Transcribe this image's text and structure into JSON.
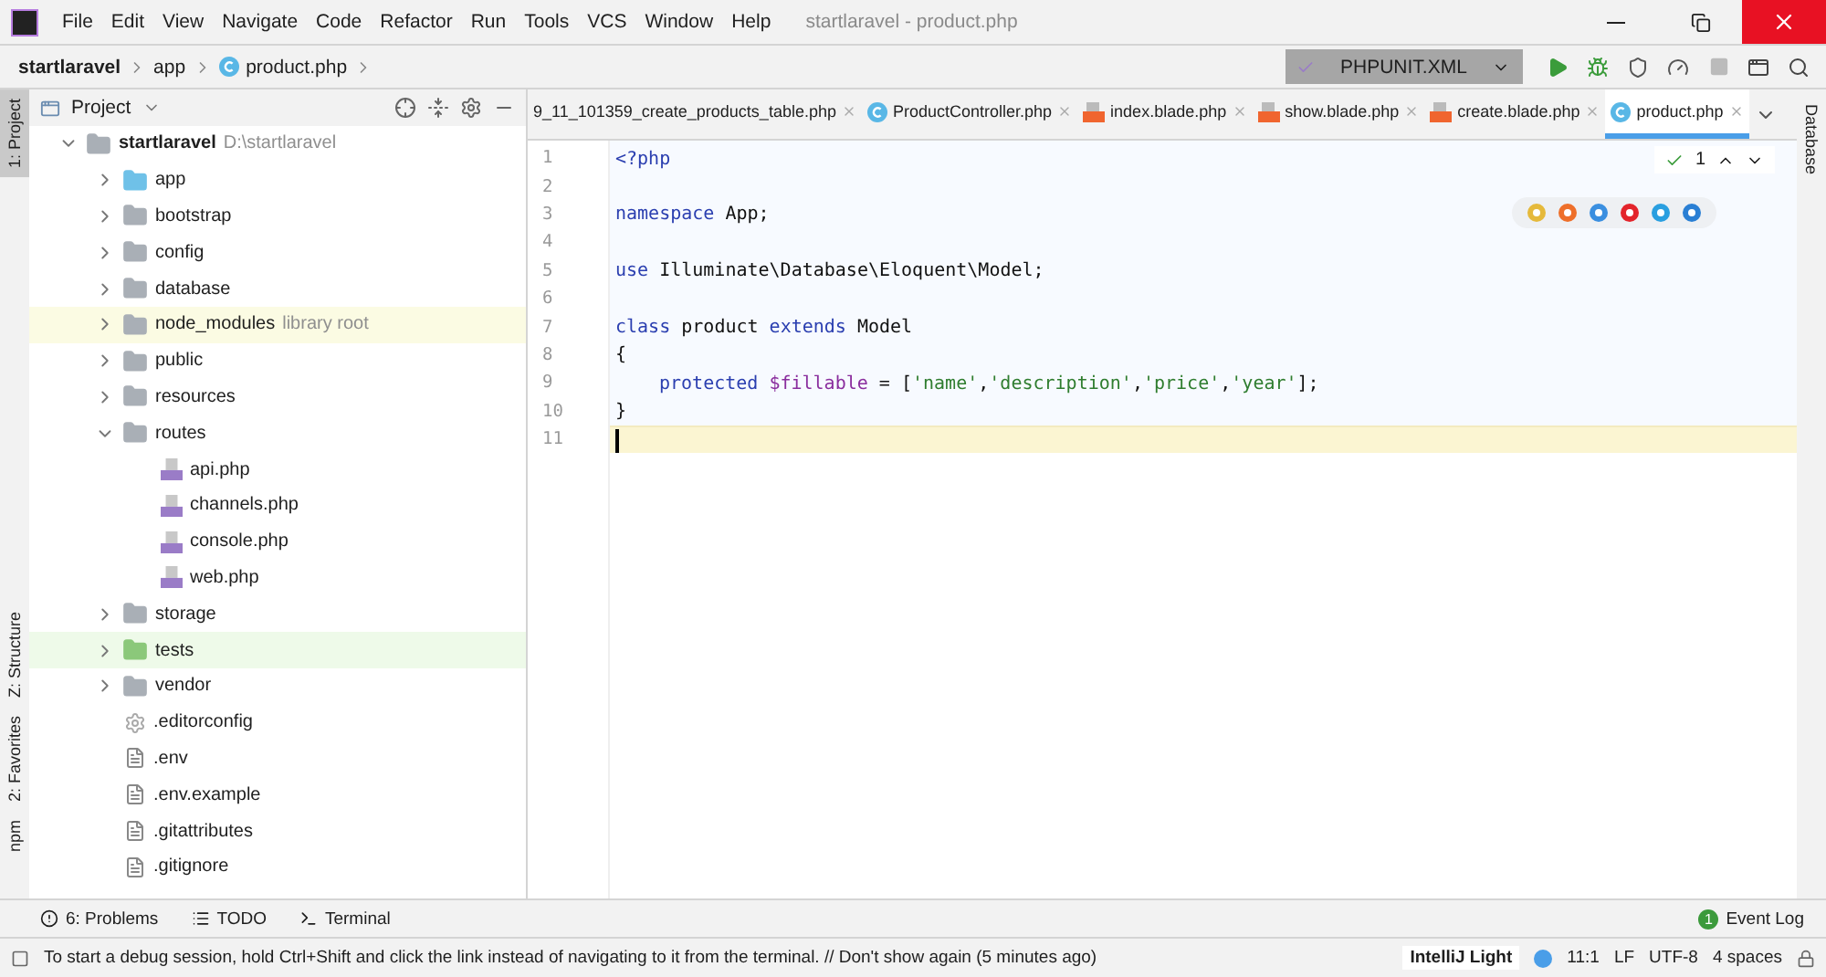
{
  "window": {
    "title": "startlaravel - product.php"
  },
  "menu": [
    "File",
    "Edit",
    "View",
    "Navigate",
    "Code",
    "Refactor",
    "Run",
    "Tools",
    "VCS",
    "Window",
    "Help"
  ],
  "breadcrumbs": [
    "startlaravel",
    "app",
    "product.php"
  ],
  "run_config": {
    "label": "PHPUNIT.XML"
  },
  "left_stripe": [
    {
      "label": "1: Project",
      "selected": true
    },
    {
      "label": "Z: Structure",
      "selected": false
    },
    {
      "label": "2: Favorites",
      "selected": false
    },
    {
      "label": "npm",
      "selected": false
    }
  ],
  "right_stripe": [
    {
      "label": "Database"
    }
  ],
  "project_panel": {
    "title": "Project",
    "tree": [
      {
        "kind": "project",
        "name": "startlaravel",
        "hint": "D:\\startlaravel",
        "expanded": true,
        "children": [
          {
            "kind": "source_folder",
            "name": "app",
            "expanded": false
          },
          {
            "kind": "folder",
            "name": "bootstrap",
            "expanded": false
          },
          {
            "kind": "folder",
            "name": "config",
            "expanded": false
          },
          {
            "kind": "folder",
            "name": "database",
            "expanded": false
          },
          {
            "kind": "library_folder",
            "name": "node_modules",
            "hint": "library root",
            "expanded": false
          },
          {
            "kind": "folder",
            "name": "public",
            "expanded": false
          },
          {
            "kind": "folder",
            "name": "resources",
            "expanded": false
          },
          {
            "kind": "folder",
            "name": "routes",
            "expanded": true,
            "children": [
              {
                "kind": "php",
                "name": "api.php"
              },
              {
                "kind": "php",
                "name": "channels.php"
              },
              {
                "kind": "php",
                "name": "console.php"
              },
              {
                "kind": "php",
                "name": "web.php"
              }
            ]
          },
          {
            "kind": "folder",
            "name": "storage",
            "expanded": false
          },
          {
            "kind": "test_folder",
            "name": "tests",
            "expanded": false
          },
          {
            "kind": "folder",
            "name": "vendor",
            "expanded": false
          },
          {
            "kind": "config",
            "name": ".editorconfig"
          },
          {
            "kind": "text",
            "name": ".env"
          },
          {
            "kind": "text",
            "name": ".env.example"
          },
          {
            "kind": "text",
            "name": ".gitattributes"
          },
          {
            "kind": "text",
            "name": ".gitignore"
          }
        ]
      }
    ]
  },
  "tabs": [
    {
      "label": "9_11_101359_create_products_table.php",
      "kind": "plain",
      "selected": false
    },
    {
      "label": "ProductController.php",
      "kind": "class",
      "selected": false
    },
    {
      "label": "index.blade.php",
      "kind": "blade",
      "selected": false
    },
    {
      "label": "show.blade.php",
      "kind": "blade",
      "selected": false
    },
    {
      "label": "create.blade.php",
      "kind": "blade",
      "selected": false
    },
    {
      "label": "product.php",
      "kind": "class",
      "selected": true
    }
  ],
  "inspection": {
    "count": "1"
  },
  "editor": {
    "lines": [
      {
        "number": "1",
        "current": false,
        "tokens": [
          {
            "kind": "keyword",
            "text": "<?php"
          }
        ]
      },
      {
        "number": "2",
        "current": false
      },
      {
        "number": "3",
        "current": false,
        "tokens": [
          {
            "kind": "keyword",
            "text": "namespace"
          },
          {
            "kind": "plain",
            "text": " App;"
          }
        ]
      },
      {
        "number": "4",
        "current": false
      },
      {
        "number": "5",
        "current": false,
        "tokens": [
          {
            "kind": "keyword",
            "text": "use"
          },
          {
            "kind": "plain",
            "text": " Illuminate\\Database\\Eloquent\\Model;"
          }
        ]
      },
      {
        "number": "6",
        "current": false
      },
      {
        "number": "7",
        "current": false,
        "tokens": [
          {
            "kind": "keyword",
            "text": "class"
          },
          {
            "kind": "plain",
            "text": " product "
          },
          {
            "kind": "keyword",
            "text": "extends"
          },
          {
            "kind": "plain",
            "text": " Model"
          }
        ]
      },
      {
        "number": "8",
        "current": false,
        "tokens": [
          {
            "kind": "plain",
            "text": "{"
          }
        ]
      },
      {
        "number": "9",
        "current": false,
        "indented": true,
        "tokens": [
          {
            "kind": "keyword",
            "text": "protected"
          },
          {
            "kind": "var",
            "text": " $fillable"
          },
          {
            "kind": "plain",
            "text": " = ["
          },
          {
            "kind": "string",
            "text": "'name'"
          },
          {
            "kind": "plain",
            "text": ","
          },
          {
            "kind": "string",
            "text": "'description'"
          },
          {
            "kind": "plain",
            "text": ","
          },
          {
            "kind": "string",
            "text": "'price'"
          },
          {
            "kind": "plain",
            "text": ","
          },
          {
            "kind": "string",
            "text": "'year'"
          },
          {
            "kind": "plain",
            "text": "];"
          }
        ]
      },
      {
        "number": "10",
        "current": false,
        "tokens": [
          {
            "kind": "plain",
            "text": "}"
          }
        ]
      },
      {
        "number": "11",
        "current": true
      }
    ]
  },
  "tool_windows": [
    {
      "label": "6: Problems",
      "kind": "problems"
    },
    {
      "label": "TODO",
      "kind": "todo"
    },
    {
      "label": "Terminal",
      "kind": "terminal"
    }
  ],
  "event_log": {
    "label": "Event Log",
    "count": "1"
  },
  "status_bar": {
    "message": "To start a debug session, hold Ctrl+Shift and click the link instead of navigating to it from the terminal. // Don't show again (5 minutes ago)",
    "theme": "IntelliJ Light",
    "position": "11:1",
    "line_separator": "LF",
    "encoding": "UTF-8",
    "indent": "4 spaces"
  }
}
